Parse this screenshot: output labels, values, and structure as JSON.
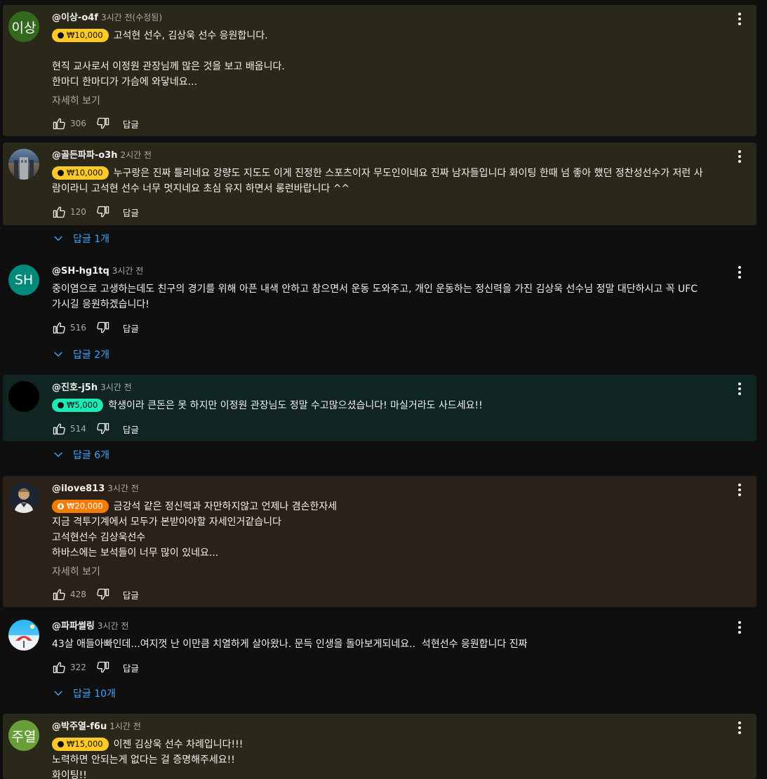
{
  "ui": {
    "more": "자세히 보기",
    "reply": "답글"
  },
  "comments": [
    {
      "author": "@이상-o4f",
      "time": "3시간 전(수정됨)",
      "avatar_text": "이상",
      "avatar_color": "#33691e",
      "card_color": "#2a2818",
      "chip": "₩10,000",
      "chip_color": "#ffca28",
      "lines": [
        "고석현 선수, 김상욱 선수 응원합니다.",
        "",
        "현직 교사로서 이정원 관장님께 많은 것을 보고 배웁니다.",
        "한마디 한마디가 가슴에 와닿네요..."
      ],
      "likes": "306",
      "replies": null
    },
    {
      "author": "@골든파파-o3h",
      "time": "2시간 전",
      "avatar_icon": "building-photo-icon",
      "card_color": "#2a2818",
      "chip": "₩10,000",
      "chip_color": "#ffca28",
      "lines": [
        "누구랑은 진짜 틀리네요 강량도 지도도 이게 진정한 스포츠이자 무도인이네요 진짜 남자들입니다 화이팅 한때 넘 좋아 했던 정찬성선수가 저런 사",
        "람이라니 고석현 선수 너무 멋지네요 초심 유지 하면서 롱런바랍니다 ^^"
      ],
      "likes": "120",
      "replies": "답글 1개"
    },
    {
      "author": "@SH-hg1tq",
      "time": "3시간 전",
      "avatar_text": "SH",
      "avatar_color": "#00897b",
      "card_color": "transparent",
      "chip": null,
      "lines": [
        "중이염으로 고생하는데도 친구의 경기를 위해 아픈 내색 안하고 참으면서 운동 도와주고, 개인 운동하는 정신력을 가진 김상욱 선수님 정말 대단하시고 꼭 UFC",
        "가시길 응원하겠습니다!"
      ],
      "likes": "516",
      "replies": "답글 2개"
    },
    {
      "author": "@진호-j5h",
      "time": "3시간 전",
      "avatar_text": "",
      "avatar_color": "#000000",
      "card_color": "#102421",
      "chip": "₩5,000",
      "chip_color": "#1de9b6",
      "lines": [
        "학생이라 큰돈은 못 하지만 이정원 관장님도 정말 수고많으셨습니다! 마실거라도 사드세요!!"
      ],
      "likes": "514",
      "replies": "답글 6개"
    },
    {
      "author": "@ilove813",
      "time": "3시간 전",
      "avatar_icon": "person-photo-icon",
      "card_color": "#2c2118",
      "chip": "₩20,000",
      "chip_color": "#f57c00",
      "lines": [
        "금강석 같은 정신력과 자만하지않고 언제나 겸손한자세",
        "지금 격투기계에서 모두가 본받아야할 자세인거같습니다",
        "고석현선수 김상욱선수",
        "하바스에는 보석들이 너무 많이 있네요..."
      ],
      "likes": "428",
      "replies": null
    },
    {
      "author": "@파파썰링",
      "time": "3시간 전",
      "avatar_icon": "beach-photo-icon",
      "card_color": "transparent",
      "chip": null,
      "lines": [
        "43살 애들아빠인데...여지껏 난 이만큼 치열하게 살아왔나. 문득 인생을 돌아보게되네요..  석현선수 응원합니다 진짜"
      ],
      "likes": "322",
      "replies": "답글 10개"
    },
    {
      "author": "@박주열-f6u",
      "time": "1시간 전",
      "avatar_text": "주열",
      "avatar_color": "#689f38",
      "card_color": "#2a2818",
      "chip": "₩15,000",
      "chip_color": "#ffca28",
      "lines": [
        "이젠 김상욱 선수 차례입니다!!!",
        "노력하면 안되는게 없다는 걸 증명해주세요!!",
        "화이팅!!"
      ],
      "likes": null,
      "replies": null
    }
  ]
}
